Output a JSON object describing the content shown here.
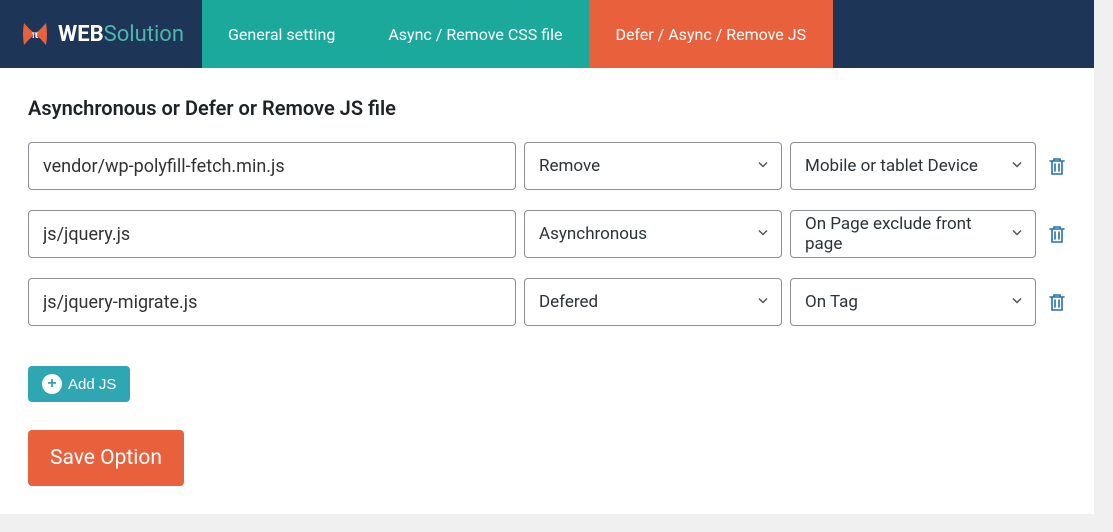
{
  "header": {
    "logo_web": "WEB",
    "logo_solution": "Solution",
    "tabs": [
      {
        "label": "General setting",
        "active": false,
        "style": "teal"
      },
      {
        "label": "Async / Remove CSS file",
        "active": false,
        "style": "teal"
      },
      {
        "label": "Defer / Async / Remove JS",
        "active": true,
        "style": "orange"
      }
    ]
  },
  "page_title": "Asynchronous or Defer or Remove JS file",
  "rows": [
    {
      "file": "vendor/wp-polyfill-fetch.min.js",
      "mode": "Remove",
      "condition": "Mobile or tablet Device"
    },
    {
      "file": "js/jquery.js",
      "mode": "Asynchronous",
      "condition": "On Page exclude front page"
    },
    {
      "file": "js/jquery-migrate.js",
      "mode": "Defered",
      "condition": "On Tag"
    }
  ],
  "buttons": {
    "add": "Add JS",
    "save": "Save Option"
  }
}
